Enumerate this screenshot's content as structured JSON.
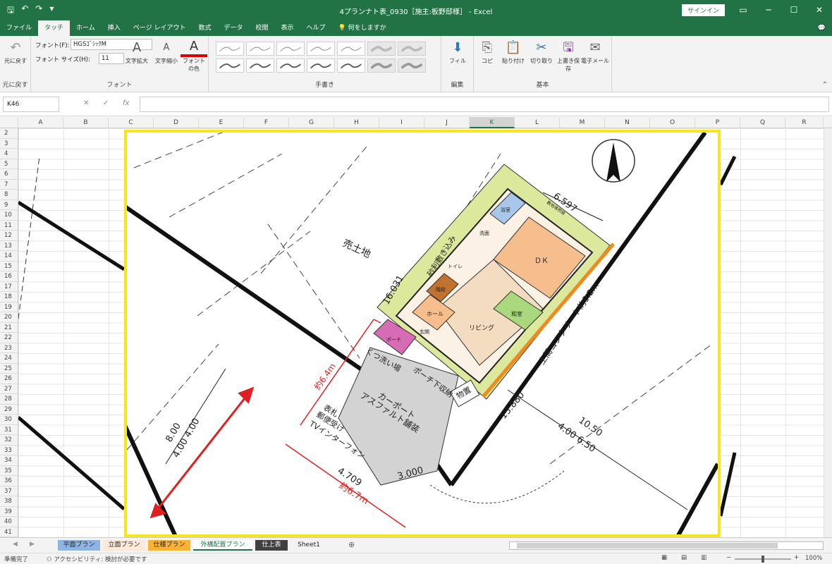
{
  "window": {
    "title": "4プランナト表_0930［施主:板野邸様］ - Excel",
    "signin": "サインイン",
    "controls": [
      "▭",
      "─",
      "☐",
      "✕"
    ]
  },
  "tabs": [
    "ファイル",
    "タッチ",
    "ホーム",
    "挿入",
    "ページ レイアウト",
    "数式",
    "データ",
    "校閲",
    "表示",
    "ヘルプ",
    "何をしますか"
  ],
  "active_tab": "タッチ",
  "ribbon": {
    "undo_label": "元に戻す",
    "undo_group": "元に戻す",
    "font_label": "フォント(F):",
    "font_value": "HGSｺﾞｼｯｸM",
    "size_label": "フォント サイズ(H):",
    "size_value": "11",
    "grow_label": "文字拡大",
    "shrink_label": "文字縮小",
    "fontcolor_label": "フォントの色",
    "font_group": "フォント",
    "pen_group": "手書き",
    "fill_label": "フィル",
    "edit_group": "編集",
    "copy_label": "コピ",
    "paste_label": "貼り付け",
    "cut_label": "切り取り",
    "save_label": "上書き保存",
    "mail_label": "電子メール",
    "basic_group": "基本"
  },
  "formula": {
    "namebox": "K46",
    "cancel": "✕",
    "enter": "✓",
    "fx": "fx",
    "value": ""
  },
  "columns": [
    "A",
    "B",
    "C",
    "D",
    "E",
    "F",
    "G",
    "H",
    "I",
    "J",
    "K",
    "L",
    "M",
    "N",
    "O",
    "P",
    "Q",
    "R"
  ],
  "selected_column": "K",
  "rows": [
    "2",
    "3",
    "4",
    "5",
    "6",
    "7",
    "8",
    "9",
    "10",
    "11",
    "12",
    "13",
    "14",
    "15",
    "16",
    "17",
    "18",
    "19",
    "20",
    "21",
    "22",
    "23",
    "24",
    "25",
    "26",
    "27",
    "28",
    "29",
    "30",
    "31",
    "32",
    "33",
    "34",
    "35",
    "36",
    "37",
    "38",
    "39",
    "40",
    "41"
  ],
  "drawing": {
    "lot_label": "売土地",
    "dim_top": "6.597",
    "dim_top_small": "敷地境界線",
    "dim_left_building": "16.031",
    "hedge_label": "砂利敷き込み",
    "concrete_label": "土間コンクリート約9.2m",
    "dim_right": "13.880",
    "dim_right_large": "10.50",
    "dim_right_split": "4.00   6.50",
    "dim_left_large": "8.00",
    "dim_left_split": "4.00   4.00",
    "dim_bottom": "4.709",
    "dim_bottom_red": "約6.7m",
    "dim_bottom_right": "3.000",
    "dim_red_left": "約6.4m",
    "shoe_wash": "くつ洗い場",
    "porch_storage": "ポーチ下収納",
    "storage_shed": "物置",
    "carport_1": "カーポート",
    "carport_2": "アスファルト舗装",
    "gate_1": "表札",
    "gate_2": "郵便受け",
    "gate_3": "TVインターフォン",
    "room_dk": "ＤＫ",
    "room_living": "リビング",
    "room_japanese": "和室",
    "room_hall": "ホール",
    "room_entry": "玄関",
    "room_toilet": "トイレ",
    "room_bath": "浴室",
    "room_wash": "洗面",
    "room_stairs": "階段",
    "room_porch": "ポーチ",
    "north": "N"
  },
  "sheets": [
    {
      "name": "平面プラン",
      "bg": "#8eb4e3"
    },
    {
      "name": "立面プラン",
      "bg": "#fde9d9"
    },
    {
      "name": "仕様プラン",
      "bg": "#f9b233"
    },
    {
      "name": "外構配置プラン",
      "bg": "#ffffff"
    },
    {
      "name": "仕上表",
      "bg": "#404040"
    },
    {
      "name": "Sheet1",
      "bg": "#f3f3f3"
    }
  ],
  "status": {
    "ready": "準備完了",
    "accessibility": "アクセシビリティ: 検討が必要です",
    "zoom": "100%"
  },
  "colors": {
    "excel_green": "#217346",
    "highlight": "#f6e71c",
    "annotation_red": "#e02020"
  }
}
